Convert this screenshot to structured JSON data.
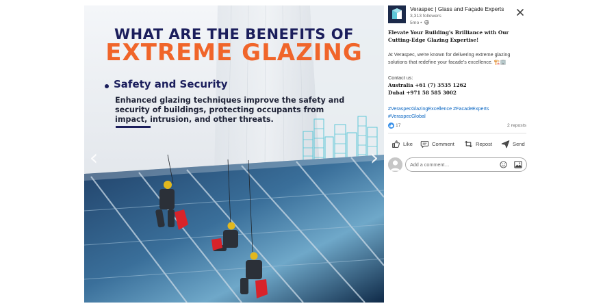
{
  "post_image": {
    "title_line1": "WHAT ARE THE BENEFITS OF",
    "title_line2": "EXTREME GLAZING",
    "bullet_heading": "Safety and Security",
    "bullet_body": "Enhanced glazing techniques improve the safety and security of buildings, protecting occupants from impact, intrusion, and other threats.",
    "prev_icon": "chevron-left-icon",
    "next_icon": "chevron-right-icon",
    "colors": {
      "navy": "#1b1e5c",
      "orange": "#f0652a",
      "skyline": "#5ec8d8"
    }
  },
  "header": {
    "company_name": "Veraspec | Glass and Façade Experts",
    "followers": "3,313 followers",
    "time": "5mo •",
    "visibility_icon": "globe-icon",
    "close_icon": "close-icon"
  },
  "post": {
    "title": "Elevate Your Building's Brilliance with Our Cutting-Edge Glazing Expertise!",
    "body": "At Veraspec, we're known for delivering extreme glazing solutions that redefine your facade's excellence. 🏗️🏢",
    "contact_label": "Contact us:",
    "phone_australia": "Australia +61 (7) 3535 1262",
    "phone_dubai": "Dubai +971 58 585 3002",
    "hashtags": "#VeraspecGlazingExcellence #FacadeExperts #VeraspecGlobal"
  },
  "social": {
    "reaction_count": "17",
    "reposts": "2 reposts"
  },
  "actions": {
    "like": "Like",
    "comment": "Comment",
    "repost": "Repost",
    "send": "Send"
  },
  "comment": {
    "placeholder": "Add a comment…",
    "emoji_icon": "emoji-icon",
    "image_icon": "image-icon"
  },
  "colors": {
    "link": "#0a66c2",
    "like_blue": "#378fe9",
    "logo_bg": "#1c2a4a"
  }
}
